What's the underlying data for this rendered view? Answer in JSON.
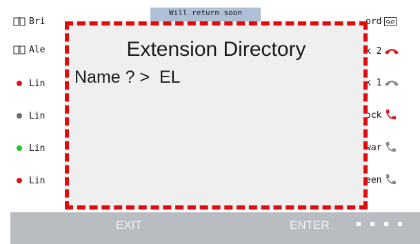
{
  "banner_text": "Will return soon",
  "left_items": [
    {
      "label": "Bri",
      "icon": "book-icon"
    },
    {
      "label": "Ale",
      "icon": "book-icon"
    },
    {
      "label": "Lin",
      "icon": "status-dot",
      "color": "#e0151b"
    },
    {
      "label": "Lin",
      "icon": "status-dot",
      "color": "#6b6b6b"
    },
    {
      "label": "Lin",
      "icon": "status-dot",
      "color": "#23c62b"
    },
    {
      "label": "Lin",
      "icon": "status-dot",
      "color": "#e0151b"
    }
  ],
  "right_items": [
    {
      "label": "ord",
      "icon": "voicemail-icon"
    },
    {
      "label": "k 2",
      "icon": "phone-hangup-icon",
      "color": "#d41820"
    },
    {
      "label": "k 1",
      "icon": "phone-hangup-icon",
      "color": "#8a8a8a"
    },
    {
      "label": "ock",
      "icon": "phone-icon",
      "color": "#d41820"
    },
    {
      "label": "war",
      "icon": "phone-icon",
      "color": "#8a8a8a"
    },
    {
      "label": "een",
      "icon": "phone-icon",
      "color": "#8a8a8a"
    }
  ],
  "popup": {
    "title": "Extension Directory",
    "prompt": "Name ? >  EL"
  },
  "softkeys": {
    "exit": "EXIT",
    "enter": "ENTER"
  },
  "colors": {
    "popup_border": "#e20b0b",
    "softkey_bar": "#b9bcc1",
    "banner": "#aebfd6"
  }
}
